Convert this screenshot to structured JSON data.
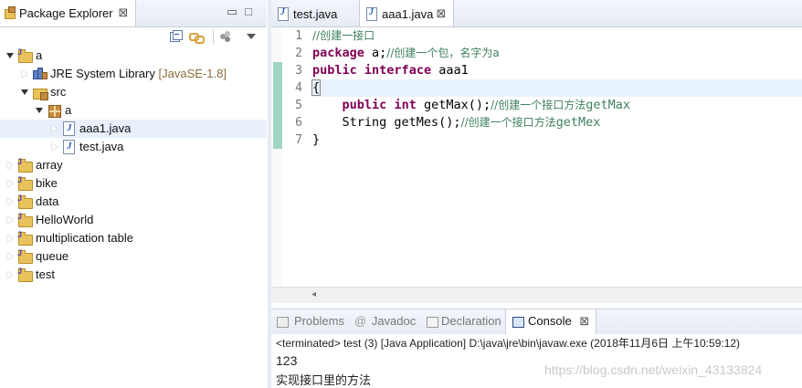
{
  "package_explorer": {
    "tab_label": "Package Explorer",
    "close_symbol": "⊠",
    "toolbar_icons": [
      "collapse-all-icon",
      "link-with-editor-icon",
      "view-menu-icon",
      "minimize-icon",
      "maximize-icon"
    ],
    "tree": {
      "project_a": "a",
      "jre_label": "JRE System Library",
      "jre_decoration": "[JavaSE-1.8]",
      "src": "src",
      "package_a": "a",
      "file_aaa1": "aaa1.java",
      "file_test": "test.java",
      "projects": [
        "array",
        "bike",
        "data",
        "HelloWorld",
        "multiplication table",
        "queue",
        "test"
      ]
    }
  },
  "editor": {
    "tabs": [
      {
        "label": "test.java",
        "active": false
      },
      {
        "label": "aaa1.java",
        "active": true
      }
    ],
    "line_numbers": [
      "1",
      "2",
      "3",
      "4",
      "5",
      "6",
      "7"
    ],
    "code": {
      "l1_comment": "//创建一接口",
      "l2_kw": "package",
      "l2_rest": " a;",
      "l2_comment": "//创建一个包，名字为a",
      "l3_kw1": "public",
      "l3_kw2": "interface",
      "l3_rest": " aaa1",
      "l4_brace": "{",
      "l5_kw1": "public",
      "l5_kw2": "int",
      "l5_rest": " getMax();",
      "l5_comment_zh": "//创建一个接口方法",
      "l5_comment_en": "getMax",
      "l6_rest": "String getMes();",
      "l6_comment_zh": "//创建一个接口方法",
      "l6_comment_en": "getMex",
      "l7_brace": "}"
    }
  },
  "console": {
    "tabs": [
      "Problems",
      "Javadoc",
      "Declaration",
      "Console"
    ],
    "active_tab": "Console",
    "status": "<terminated> test (3) [Java Application] D:\\java\\jre\\bin\\javaw.exe (2018年11月6日 上午10:59:12)",
    "output": [
      "123",
      "实现接口里的方法"
    ]
  },
  "watermark": "https://blog.csdn.net/weixin_43133824",
  "colors": {
    "keyword": "#7f0055",
    "comment": "#3f7f5f",
    "current_line": "#e8f2fe",
    "selection": "#e8f0fc"
  }
}
